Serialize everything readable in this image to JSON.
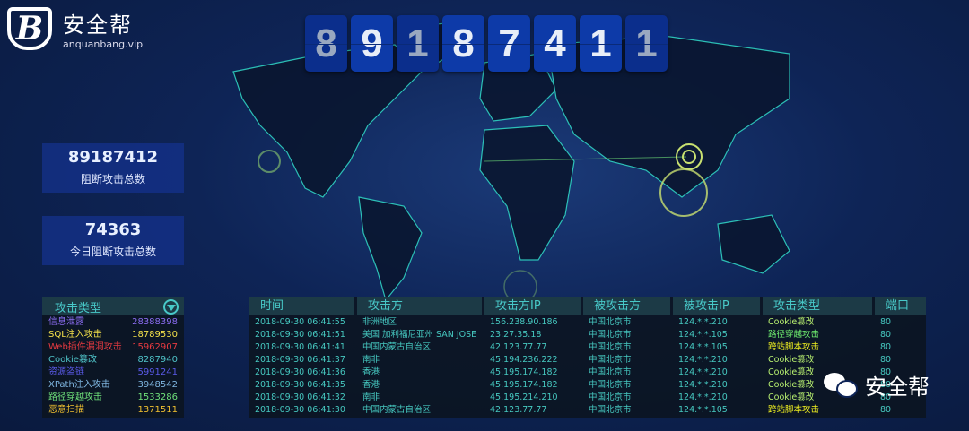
{
  "brand": {
    "name": "安全帮",
    "domain": "anquanbang.vip",
    "mark": "B"
  },
  "counter": {
    "digits": [
      "8",
      "9",
      "1",
      "8",
      "7",
      "4",
      "1",
      "1"
    ]
  },
  "stats": [
    {
      "value": "89187412",
      "label": "阻断攻击总数"
    },
    {
      "value": "74363",
      "label": "今日阻断攻击总数"
    }
  ],
  "attack_types": {
    "title": "攻击类型",
    "toggle_icon": "triangle-down-icon",
    "items": [
      {
        "name": "信息泄露",
        "count": "28388398",
        "color": "#8a6cf0"
      },
      {
        "name": "SQL注入攻击",
        "count": "18789530",
        "color": "#f3e04a"
      },
      {
        "name": "Web插件漏洞攻击",
        "count": "15962907",
        "color": "#e83a40"
      },
      {
        "name": "Cookie篡改",
        "count": "8287940",
        "color": "#4fc3c8"
      },
      {
        "name": "资源盗链",
        "count": "5991241",
        "color": "#5a5ae8"
      },
      {
        "name": "XPath注入攻击",
        "count": "3948542",
        "color": "#7fb6e0"
      },
      {
        "name": "路径穿越攻击",
        "count": "1533286",
        "color": "#6fe07a"
      },
      {
        "name": "恶意扫描",
        "count": "1371511",
        "color": "#f0c030"
      }
    ]
  },
  "log": {
    "headers": [
      "时间",
      "攻击方",
      "攻击方IP",
      "被攻击方",
      "被攻击IP",
      "攻击类型",
      "端口"
    ],
    "rows": [
      [
        "2018-09-30 06:41:55",
        "非洲地区",
        "156.238.90.186",
        "中国北京市",
        "124.*.*.210",
        "Cookie篡改",
        "80"
      ],
      [
        "2018-09-30 06:41:51",
        "美国 加利福尼亚州 SAN JOSE",
        "23.27.35.18",
        "中国北京市",
        "124.*.*.105",
        "路径穿越攻击",
        "80"
      ],
      [
        "2018-09-30 06:41:41",
        "中国内蒙古自治区",
        "42.123.77.77",
        "中国北京市",
        "124.*.*.105",
        "跨站脚本攻击",
        "80"
      ],
      [
        "2018-09-30 06:41:37",
        "南非",
        "45.194.236.222",
        "中国北京市",
        "124.*.*.210",
        "Cookie篡改",
        "80"
      ],
      [
        "2018-09-30 06:41:36",
        "香港",
        "45.195.174.182",
        "中国北京市",
        "124.*.*.210",
        "Cookie篡改",
        "80"
      ],
      [
        "2018-09-30 06:41:35",
        "香港",
        "45.195.174.182",
        "中国北京市",
        "124.*.*.210",
        "Cookie篡改",
        "80"
      ],
      [
        "2018-09-30 06:41:32",
        "南非",
        "45.195.214.210",
        "中国北京市",
        "124.*.*.210",
        "Cookie篡改",
        "80"
      ],
      [
        "2018-09-30 06:41:30",
        "中国内蒙古自治区",
        "42.123.77.77",
        "中国北京市",
        "124.*.*.105",
        "跨站脚本攻击",
        "80"
      ]
    ],
    "type_colors": {
      "Cookie篡改": "#b8f070",
      "路径穿越攻击": "#70f070",
      "跨站脚本攻击": "#f0f020"
    }
  },
  "watermark": {
    "text": "安全帮",
    "icon": "wechat-icon"
  }
}
